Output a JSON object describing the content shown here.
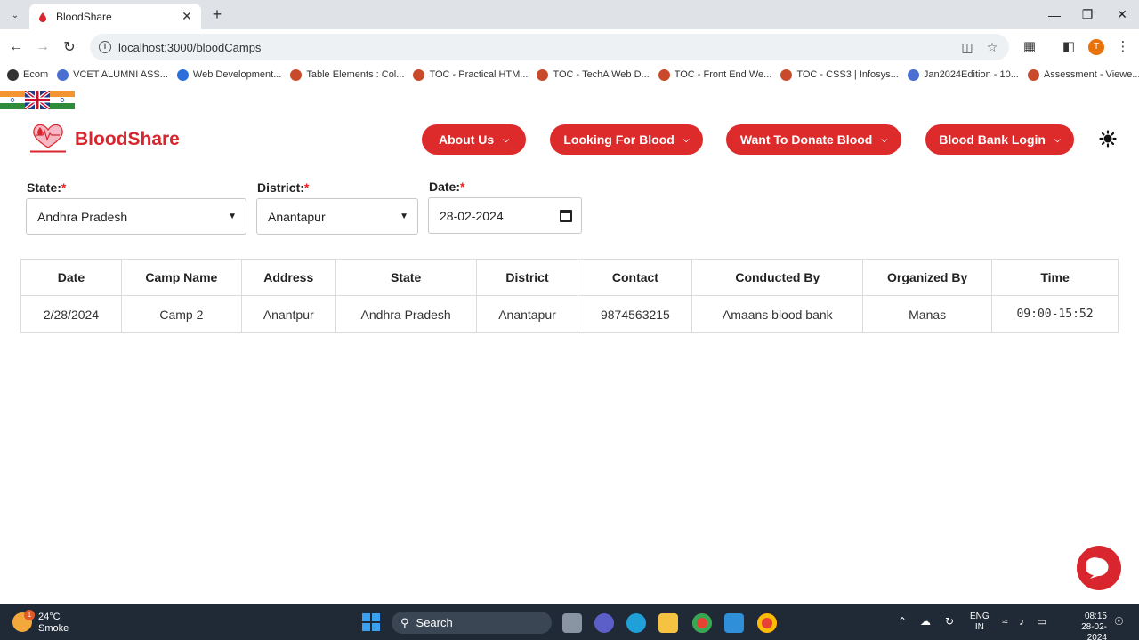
{
  "browser": {
    "tab_title": "BloodShare",
    "url": "localhost:3000/bloodCamps",
    "profile_initial": "T",
    "bookmarks": [
      {
        "label": "Ecom",
        "color": "#333333"
      },
      {
        "label": "VCET ALUMNI ASS...",
        "color": "#4a6fd1"
      },
      {
        "label": "Web Development...",
        "color": "#2a6fdb"
      },
      {
        "label": "Table Elements : Col...",
        "color": "#c94a2a"
      },
      {
        "label": "TOC - Practical HTM...",
        "color": "#c94a2a"
      },
      {
        "label": "TOC - TechA Web D...",
        "color": "#c94a2a"
      },
      {
        "label": "TOC - Front End We...",
        "color": "#c94a2a"
      },
      {
        "label": "TOC - CSS3 | Infosys...",
        "color": "#c94a2a"
      },
      {
        "label": "Jan2024Edition - 10...",
        "color": "#4a6fd1"
      },
      {
        "label": "Assessment - Viewe...",
        "color": "#c94a2a"
      }
    ]
  },
  "site": {
    "brand": "BloodShare",
    "accent_color": "#dd2a2a",
    "nav": [
      {
        "label": "About Us"
      },
      {
        "label": "Looking For Blood"
      },
      {
        "label": "Want To Donate Blood"
      },
      {
        "label": "Blood Bank Login"
      }
    ]
  },
  "filters": {
    "state_label": "State:",
    "state_value": "Andhra Pradesh",
    "district_label": "District:",
    "district_value": "Anantapur",
    "date_label": "Date:",
    "date_value": "28-02-2024",
    "required_marker": "*"
  },
  "table": {
    "headers": [
      "Date",
      "Camp Name",
      "Address",
      "State",
      "District",
      "Contact",
      "Conducted By",
      "Organized By",
      "Time"
    ],
    "rows": [
      [
        "2/28/2024",
        "Camp 2",
        "Anantpur",
        "Andhra Pradesh",
        "Anantapur",
        "9874563215",
        "Amaans blood bank",
        "Manas",
        "09:00-15:52"
      ]
    ]
  },
  "taskbar": {
    "weather_temp": "24°C",
    "weather_desc": "Smoke",
    "weather_badge": "1",
    "search_label": "Search",
    "lang_top": "ENG",
    "lang_bottom": "IN",
    "time": "08:15",
    "date": "28-02-2024"
  }
}
